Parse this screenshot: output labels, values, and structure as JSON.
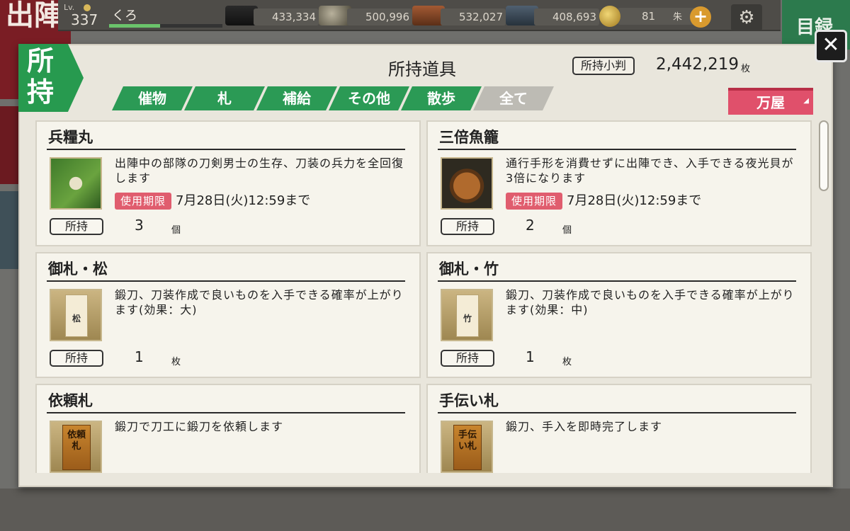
{
  "background": {
    "left_chars": "出陣",
    "right_button": "目録"
  },
  "topbar": {
    "level_label": "Lv.",
    "level": "337",
    "player_name": "くろ",
    "exp_fraction": 0.45,
    "resources": [
      {
        "icon": "charcoal-icon",
        "value": "433,334"
      },
      {
        "icon": "tamahagane-icon",
        "value": "500,996"
      },
      {
        "icon": "cooling-material-icon",
        "value": "532,027"
      },
      {
        "icon": "whetstone-icon",
        "value": "408,693"
      }
    ],
    "coins": "81",
    "coin_unit": "朱",
    "plus_label": "+",
    "gear_icon": "⚙"
  },
  "modal": {
    "badge": "所持",
    "title": "所持道具",
    "koban_label": "所持小判",
    "koban_value": "2,442,219",
    "koban_unit": "枚",
    "close_label": "✕",
    "tabs": [
      {
        "label": "催物",
        "active": false
      },
      {
        "label": "札",
        "active": false
      },
      {
        "label": "補給",
        "active": false
      },
      {
        "label": "その他",
        "active": false
      },
      {
        "label": "散歩",
        "active": false
      },
      {
        "label": "全て",
        "active": true
      }
    ],
    "shop_label": "万屋",
    "shop_chevron": "◢"
  },
  "items": [
    {
      "name": "兵糧丸",
      "icon": "dango-icon",
      "description": "出陣中の部隊の刀剣男士の生存、刀装の兵力を全回復します",
      "expiry_label": "使用期限",
      "expiry": "7月28日(火)12:59まで",
      "own_label": "所持",
      "count": "3",
      "unit": "個"
    },
    {
      "name": "三倍魚籠",
      "icon": "basket-icon",
      "description": "通行手形を消費せずに出陣でき、入手できる夜光貝が3倍になります",
      "expiry_label": "使用期限",
      "expiry": "7月28日(火)12:59まで",
      "own_label": "所持",
      "count": "2",
      "unit": "個"
    },
    {
      "name": "御札・松",
      "icon": "talisman-pine-icon",
      "slip_text": "松",
      "description": "鍛刀、刀装作成で良いものを入手できる確率が上がります(効果：大)",
      "own_label": "所持",
      "count": "1",
      "unit": "枚"
    },
    {
      "name": "御札・竹",
      "icon": "talisman-bamboo-icon",
      "slip_text": "竹",
      "description": "鍛刀、刀装作成で良いものを入手できる確率が上がります(効果：中)",
      "own_label": "所持",
      "count": "1",
      "unit": "枚"
    },
    {
      "name": "依頼札",
      "icon": "request-plank-icon",
      "plank_text": "依頼札",
      "description": "鍛刀で刀工に鍛刀を依頼します"
    },
    {
      "name": "手伝い札",
      "icon": "helper-plank-icon",
      "plank_text": "手伝い札",
      "description": "鍛刀、手入を即時完了します"
    }
  ]
}
